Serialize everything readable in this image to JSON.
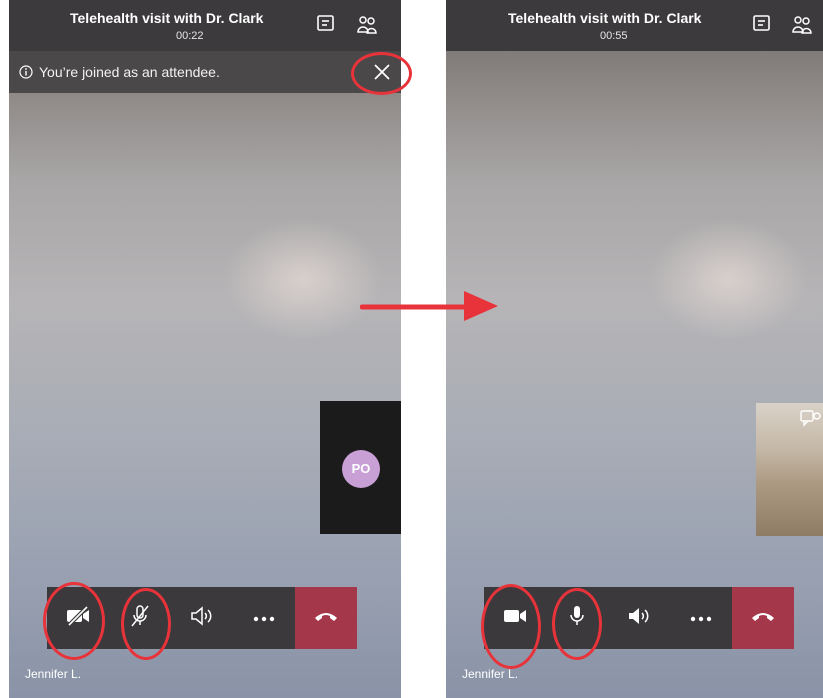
{
  "left_screen": {
    "title": "Telehealth visit with Dr. Clark",
    "timer": "00:22",
    "banner_text": "You’re joined as an attendee.",
    "participant_initials": "PO",
    "name_label": "Jennifer L.",
    "camera_state": "off",
    "mic_state": "muted"
  },
  "right_screen": {
    "title": "Telehealth visit with Dr. Clark",
    "timer": "00:55",
    "name_label": "Jennifer L.",
    "camera_state": "on",
    "mic_state": "on"
  },
  "icons": {
    "chat": "chat-icon",
    "participants": "participants-icon",
    "info": "info-icon",
    "close": "close-icon",
    "camera": "camera-icon",
    "camera_off": "camera-off-icon",
    "mic": "mic-icon",
    "mic_off": "mic-off-icon",
    "speaker": "speaker-icon",
    "more": "more-icon",
    "hang_up": "hang-up-icon",
    "switch_camera": "switch-camera-icon"
  },
  "colors": {
    "top_bar": "#3d3a3d",
    "call_bar": "#3b393c",
    "end_call": "#a4374a",
    "avatar": "#c8a0d6",
    "annotation": "#e8333a"
  }
}
